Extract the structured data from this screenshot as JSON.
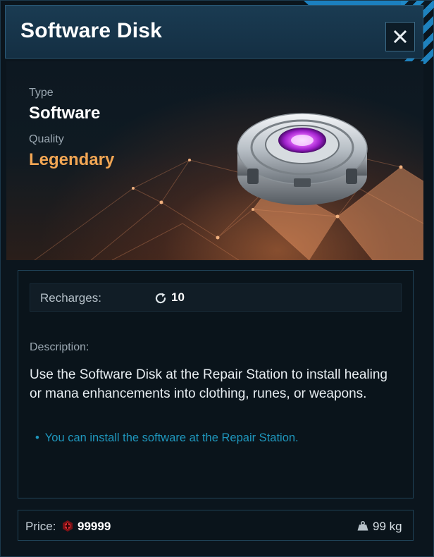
{
  "window": {
    "title": "Software Disk",
    "close_icon": "close-icon"
  },
  "item": {
    "type_label": "Type",
    "type_value": "Software",
    "quality_label": "Quality",
    "quality_value": "Legendary",
    "quality_color": "#f2a654",
    "image_icon": "software-disk-icon"
  },
  "stats": {
    "recharges_label": "Recharges:",
    "recharges_icon": "refresh-icon",
    "recharges_value": "10"
  },
  "description": {
    "label": "Description:",
    "text": "Use the Software Disk at the Repair Station to install healing or mana enhancements into clothing, runes, or weapons.",
    "bullets": [
      "You can install the software at the Repair Station."
    ],
    "bullet_color": "#1f97bd"
  },
  "footer": {
    "price_label": "Price:",
    "price_icon": "currency-icon",
    "price_value": "99999",
    "weight_icon": "weight-icon",
    "weight_value": "99 kg"
  },
  "colors": {
    "header_bg": "#173548",
    "accent_blue": "#1f88c7",
    "panel_border": "#1f4256"
  }
}
